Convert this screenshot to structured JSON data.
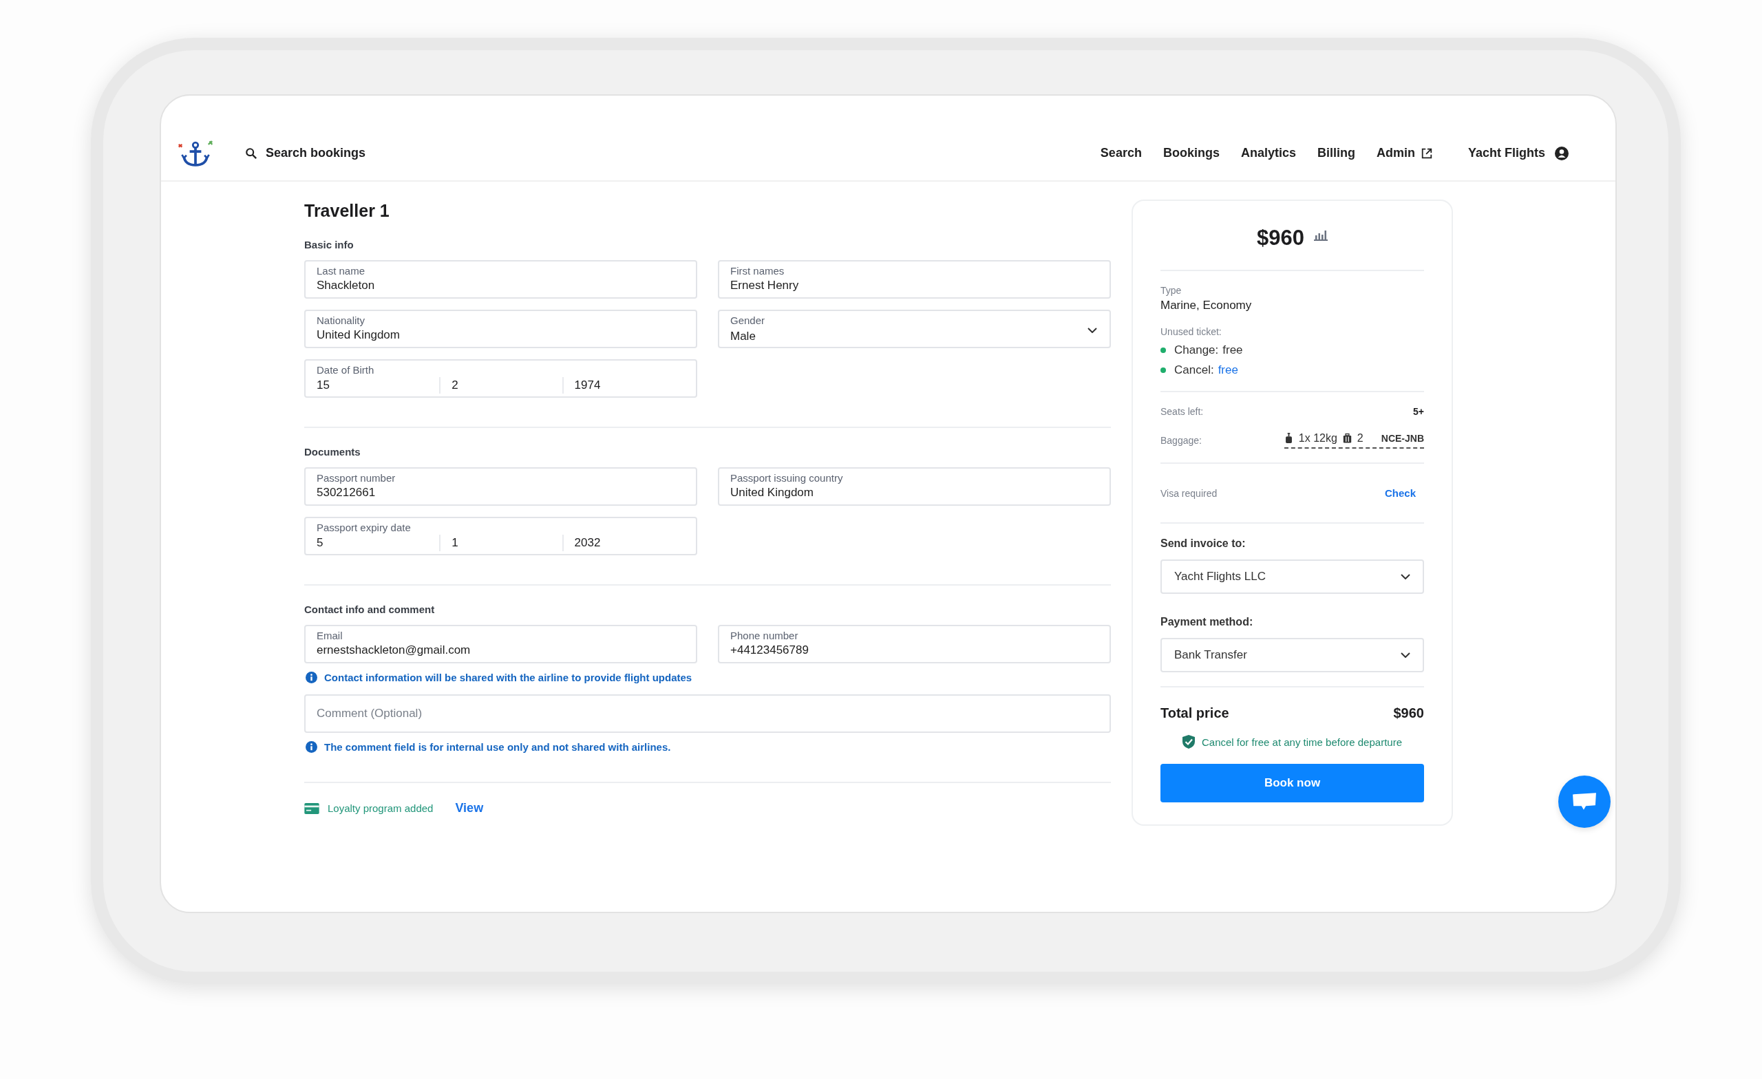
{
  "header": {
    "search_placeholder": "Search bookings",
    "nav": [
      {
        "label": "Search",
        "external": false
      },
      {
        "label": "Bookings",
        "external": false
      },
      {
        "label": "Analytics",
        "external": false
      },
      {
        "label": "Billing",
        "external": false
      },
      {
        "label": "Admin",
        "external": true
      }
    ],
    "account": "Yacht Flights"
  },
  "traveller": {
    "title": "Traveller 1",
    "sections": [
      {
        "heading": "Basic info",
        "items": [
          {
            "kind": "row",
            "fields": [
              {
                "kind": "text",
                "label": "Last name",
                "value": "Shackleton"
              },
              {
                "kind": "text",
                "label": "First names",
                "value": "Ernest Henry"
              }
            ]
          },
          {
            "kind": "row",
            "fields": [
              {
                "kind": "text",
                "label": "Nationality",
                "value": "United Kingdom"
              },
              {
                "kind": "select",
                "label": "Gender",
                "value": "Male"
              }
            ]
          },
          {
            "kind": "row",
            "fields": [
              {
                "kind": "date",
                "label": "Date of Birth",
                "parts": [
                  "15",
                  "2",
                  "1974"
                ]
              }
            ]
          }
        ]
      },
      {
        "heading": "Documents",
        "items": [
          {
            "kind": "row",
            "fields": [
              {
                "kind": "text",
                "label": "Passport number",
                "value": "530212661"
              },
              {
                "kind": "text",
                "label": "Passport issuing country",
                "value": "United Kingdom"
              }
            ]
          },
          {
            "kind": "row",
            "fields": [
              {
                "kind": "date",
                "label": "Passport expiry date",
                "parts": [
                  "5",
                  "1",
                  "2032"
                ]
              }
            ]
          }
        ]
      },
      {
        "heading": "Contact info and comment",
        "items": [
          {
            "kind": "row",
            "fields": [
              {
                "kind": "text",
                "label": "Email",
                "value": "ernestshackleton@gmail.com"
              },
              {
                "kind": "text",
                "label": "Phone number",
                "value": "+44123456789"
              }
            ]
          },
          {
            "kind": "note",
            "text": "Contact information will be shared with the airline to provide flight updates"
          },
          {
            "kind": "comment",
            "placeholder": "Comment (Optional)"
          },
          {
            "kind": "note",
            "text": "The comment field is for internal use only and not shared with airlines."
          }
        ]
      }
    ],
    "loyalty": {
      "text": "Loyalty program added",
      "link": "View"
    }
  },
  "summary": {
    "price": "$960",
    "type_label": "Type",
    "type_value": "Marine, Economy",
    "unused_label": "Unused ticket:",
    "conditions": [
      {
        "label": "Change:",
        "value": "free",
        "link": false
      },
      {
        "label": "Cancel:",
        "value": "free",
        "link": true
      }
    ],
    "seats_label": "Seats left:",
    "seats_value": "5+",
    "baggage_label": "Baggage:",
    "cabin_bag": "1x 12kg",
    "checked_bag": "2",
    "route": "NCE-JNB",
    "visa_label": "Visa required",
    "visa_link": "Check",
    "invoice_label": "Send invoice to:",
    "invoice_value": "Yacht Flights LLC",
    "payment_label": "Payment method:",
    "payment_value": "Bank Transfer",
    "total_label": "Total price",
    "total_value": "$960",
    "guarantee": "Cancel for free at any time before departure",
    "book_button": "Book now"
  }
}
